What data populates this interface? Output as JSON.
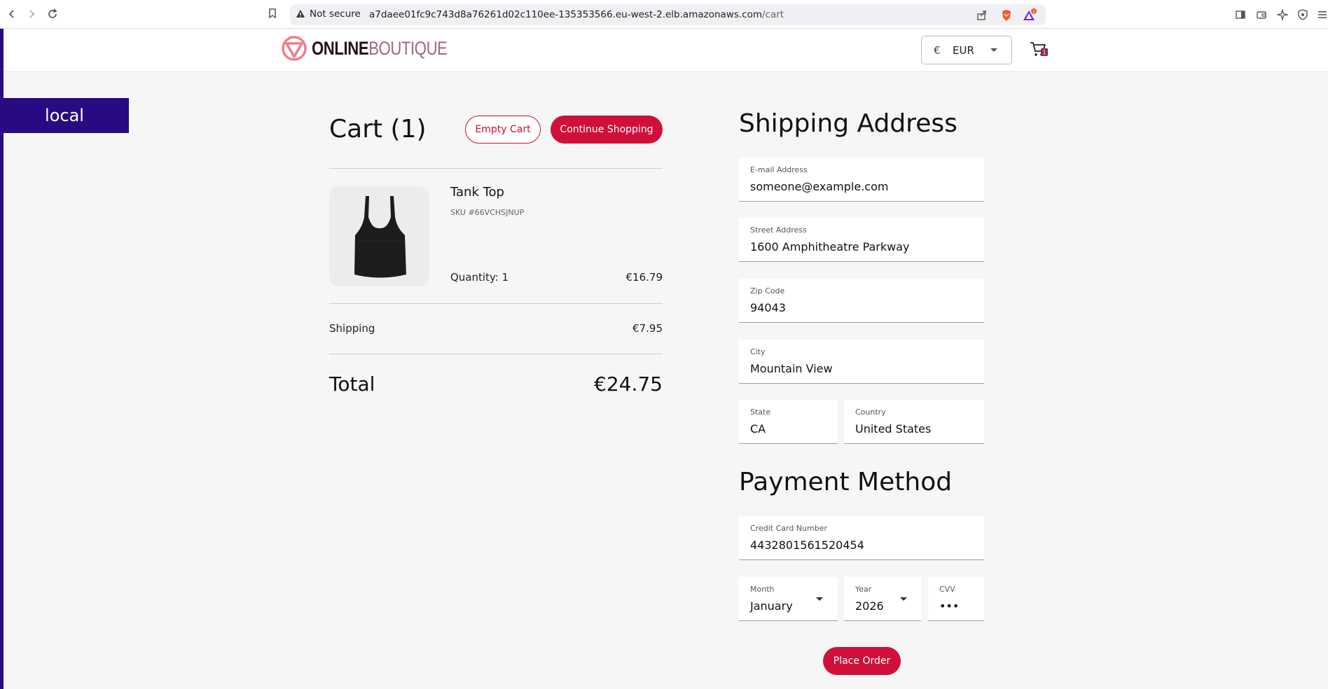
{
  "browser": {
    "security_label": "Not secure",
    "url_host": "a7daee01fc9c743d8a76261d02c110ee-135353566.eu-west-2.elb.amazonaws.com",
    "url_path": "/cart",
    "notification_count": "1"
  },
  "header": {
    "logo_bold": "ONLINE",
    "logo_light": "BOUTIQUE",
    "currency_symbol": "€",
    "currency_code": "EUR",
    "cart_count": "1"
  },
  "env_banner": "local",
  "cart": {
    "title": "Cart (1)",
    "empty_label": "Empty Cart",
    "continue_label": "Continue Shopping",
    "items": [
      {
        "name": "Tank Top",
        "sku": "SKU #66VCHSJNUP",
        "quantity": "Quantity: 1",
        "price": "€16.79"
      }
    ],
    "shipping_label": "Shipping",
    "shipping_value": "€7.95",
    "total_label": "Total",
    "total_value": "€24.75"
  },
  "shipping": {
    "title": "Shipping Address",
    "email": {
      "label": "E-mail Address",
      "value": "someone@example.com"
    },
    "street": {
      "label": "Street Address",
      "value": "1600 Amphitheatre Parkway"
    },
    "zip": {
      "label": "Zip Code",
      "value": "94043"
    },
    "city": {
      "label": "City",
      "value": "Mountain View"
    },
    "state": {
      "label": "State",
      "value": "CA"
    },
    "country": {
      "label": "Country",
      "value": "United States"
    }
  },
  "payment": {
    "title": "Payment Method",
    "card": {
      "label": "Credit Card Number",
      "value": "4432801561520454"
    },
    "month": {
      "label": "Month",
      "value": "January"
    },
    "year": {
      "label": "Year",
      "value": "2026"
    },
    "cvv": {
      "label": "CVV",
      "value": "•••"
    },
    "place_order_label": "Place Order"
  },
  "colors": {
    "accent": "#d0103a",
    "env_banner": "#2a0a82",
    "background": "#f6f6f6"
  }
}
